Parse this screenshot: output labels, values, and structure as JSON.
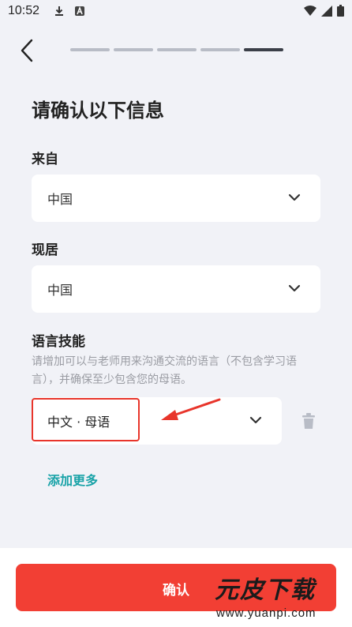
{
  "status_bar": {
    "time": "10:52"
  },
  "header": {
    "progress_steps": 5,
    "progress_active_index": 4
  },
  "page_title": "请确认以下信息",
  "from": {
    "label": "来自",
    "value": "中国"
  },
  "residence": {
    "label": "现居",
    "value": "中国"
  },
  "language": {
    "label": "语言技能",
    "hint": "请增加可以与老师用来沟通交流的语言（不包含学习语言），并确保至少包含您的母语。",
    "entries": [
      {
        "value": "中文 · 母语"
      }
    ],
    "add_more": "添加更多"
  },
  "confirm_label": "确认",
  "watermark": {
    "brand": "元皮下载",
    "url": "www.yuanpi.com"
  },
  "colors": {
    "accent": "#f23f34",
    "link": "#1aa3a8",
    "annotation": "#e8352b"
  }
}
